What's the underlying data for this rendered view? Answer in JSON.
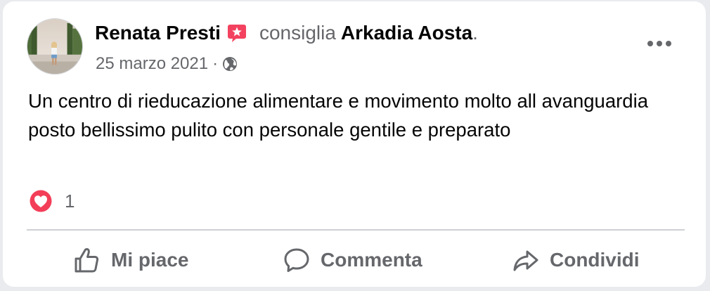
{
  "post": {
    "author": "Renata Presti",
    "recommends_text": "consiglia",
    "page_name": "Arkadia Aosta",
    "period": ".",
    "date": "25 marzo 2021",
    "separator": "·",
    "audience_icon": "globe-icon",
    "recommend_icon": "recommend-star-icon",
    "more_icon": "more-options-icon",
    "text": "Un centro di rieducazione alimentare e movimento molto all avanguardia posto bellissimo pulito con personale gentile e preparato"
  },
  "reactions": {
    "icon": "love-reaction-icon",
    "count": "1"
  },
  "actions": {
    "like_label": "Mi piace",
    "comment_label": "Commenta",
    "share_label": "Condividi"
  },
  "colors": {
    "background": "#e9ebee",
    "card": "#ffffff",
    "primary_text": "#050505",
    "secondary_text": "#65676b",
    "recommend_badge": "#f3425f",
    "love_reaction": "#f33e58",
    "divider": "#ced0d4"
  }
}
